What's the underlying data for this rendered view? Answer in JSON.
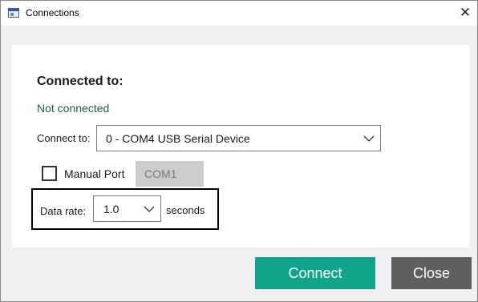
{
  "window": {
    "title": "Connections",
    "icon": "window-app-icon",
    "close_glyph": "✕"
  },
  "section": {
    "heading": "Connected to:",
    "status": "Not connected",
    "status_color": "#1d5c4b"
  },
  "connect_to": {
    "label": "Connect to:",
    "selected": "0 - COM4 USB Serial Device",
    "icon": "chevron-down-icon"
  },
  "manual_port": {
    "label": "Manual Port",
    "checked": false,
    "value": "COM1"
  },
  "data_rate": {
    "label": "Data rate:",
    "selected": "1.0",
    "unit": "seconds"
  },
  "buttons": {
    "connect": "Connect",
    "close": "Close",
    "connect_color": "#10a58a",
    "close_color": "#5f5f5f"
  }
}
